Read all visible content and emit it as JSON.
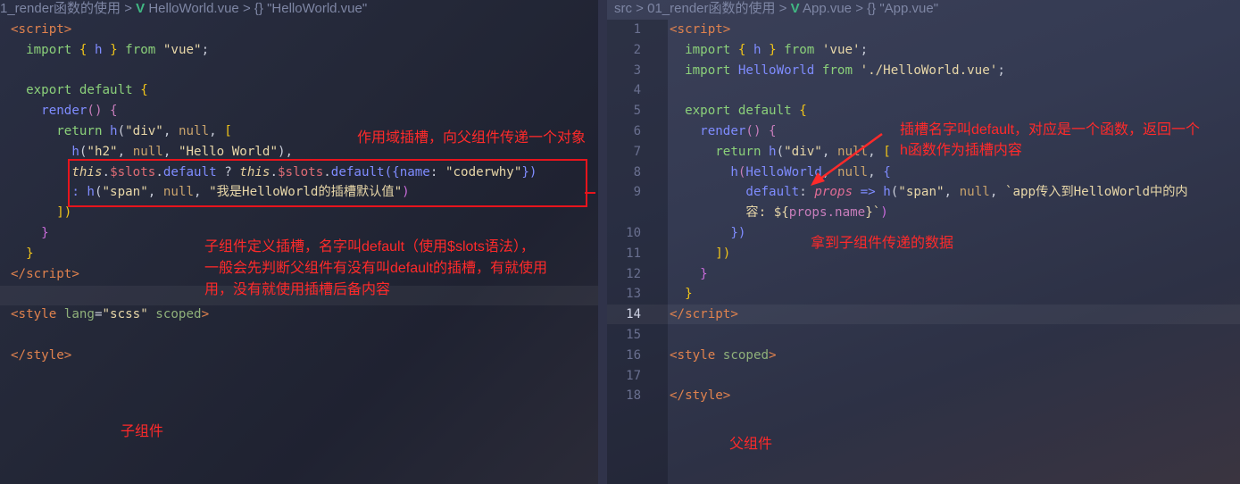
{
  "left": {
    "breadcrumb": {
      "folder": "1_render函数的使用",
      "file": "HelloWorld.vue",
      "symbol": "\"HelloWorld.vue\"",
      "sep": ">",
      "vue_icon": "V",
      "sym_icon": "{}"
    },
    "lines": [
      [
        [
          "<script>",
          "tag"
        ]
      ],
      [
        [
          "  import ",
          "kw"
        ],
        [
          "{ ",
          "br"
        ],
        [
          "h ",
          "fn"
        ],
        [
          "} ",
          "br"
        ],
        [
          "from ",
          "kw"
        ],
        [
          "\"vue\"",
          "str"
        ],
        [
          ";",
          "pu"
        ]
      ],
      [],
      [
        [
          "  export default ",
          "kw"
        ],
        [
          "{",
          "br"
        ]
      ],
      [
        [
          "    render",
          "fn"
        ],
        [
          "() ",
          "pr"
        ],
        [
          "{",
          "pr"
        ]
      ],
      [
        [
          "      return ",
          "kw"
        ],
        [
          "h",
          "fn"
        ],
        [
          "(",
          "pu"
        ],
        [
          "\"div\"",
          "str"
        ],
        [
          ", ",
          "pu"
        ],
        [
          "null",
          "nul"
        ],
        [
          ", ",
          "pu"
        ],
        [
          "[",
          "br"
        ]
      ],
      [
        [
          "        h",
          "fn"
        ],
        [
          "(",
          "pu"
        ],
        [
          "\"h2\"",
          "str"
        ],
        [
          ", ",
          "pu"
        ],
        [
          "null",
          "nul"
        ],
        [
          ", ",
          "pu"
        ],
        [
          "\"Hello World\"",
          "str"
        ],
        [
          "),",
          "pu"
        ]
      ],
      [
        [
          "        "
        ],
        [
          "this",
          "th"
        ],
        [
          ".",
          "pu"
        ],
        [
          "$slots",
          "sl"
        ],
        [
          ".",
          "pu"
        ],
        [
          "default",
          "fn"
        ],
        [
          " ? ",
          "pu"
        ],
        [
          "this",
          "th"
        ],
        [
          ".",
          "pu"
        ],
        [
          "$slots",
          "sl"
        ],
        [
          ".",
          "pu"
        ],
        [
          "default",
          "fn"
        ],
        [
          "({",
          "fn"
        ],
        [
          "name",
          "fn"
        ],
        [
          ": ",
          "pu"
        ],
        [
          "\"coderwhy\"",
          "str"
        ],
        [
          "})",
          "fn"
        ]
      ],
      [
        [
          "        : ",
          "fn"
        ],
        [
          "h",
          "fn"
        ],
        [
          "(",
          "pu"
        ],
        [
          "\"span\"",
          "str"
        ],
        [
          ", ",
          "pu"
        ],
        [
          "null",
          "nul"
        ],
        [
          ", ",
          "pu"
        ],
        [
          "\"我是HelloWorld的插槽默认值\"",
          "str"
        ],
        [
          ")",
          "pb"
        ]
      ],
      [
        [
          "      ])",
          "br"
        ]
      ],
      [
        [
          "    }",
          "pb"
        ]
      ],
      [
        [
          "  }",
          "br"
        ]
      ],
      [
        [
          "</script>",
          "tag"
        ]
      ],
      [],
      [
        [
          "<style ",
          "tag"
        ],
        [
          "lang",
          "at"
        ],
        [
          "=",
          "pu"
        ],
        [
          "\"scss\"",
          "str"
        ],
        [
          " scoped",
          "at"
        ],
        [
          ">",
          "tag"
        ]
      ],
      [],
      [
        [
          "</style>",
          "tag"
        ]
      ]
    ],
    "notes": {
      "scoped_slot": "作用域插槽，向父组件传递一个对象",
      "define_slot_1": "子组件定义插槽，名字叫default（使用$slots语法），",
      "define_slot_2": "一般会先判断父组件有没有叫default的插槽，有就使用",
      "define_slot_3": "用，没有就使用插槽后备内容",
      "label": "子组件"
    }
  },
  "right": {
    "breadcrumb": {
      "root": "src",
      "folder": "01_render函数的使用",
      "file": "App.vue",
      "symbol": "\"App.vue\"",
      "sep": ">",
      "vue_icon": "V",
      "sym_icon": "{}"
    },
    "current_line": 14,
    "lines": [
      {
        "n": "1",
        "t": [
          [
            "<script>",
            "tag"
          ]
        ]
      },
      {
        "n": "2",
        "t": [
          [
            "  import ",
            "kw"
          ],
          [
            "{ ",
            "br"
          ],
          [
            "h ",
            "fn"
          ],
          [
            "} ",
            "br"
          ],
          [
            "from ",
            "kw"
          ],
          [
            "'vue'",
            "str"
          ],
          [
            ";",
            "pu"
          ]
        ]
      },
      {
        "n": "3",
        "t": [
          [
            "  import ",
            "kw"
          ],
          [
            "HelloWorld ",
            "fn"
          ],
          [
            "from ",
            "kw"
          ],
          [
            "'./HelloWorld.vue'",
            "str"
          ],
          [
            ";",
            "pu"
          ]
        ]
      },
      {
        "n": "4",
        "t": []
      },
      {
        "n": "5",
        "t": [
          [
            "  export default ",
            "kw"
          ],
          [
            "{",
            "br"
          ]
        ]
      },
      {
        "n": "6",
        "t": [
          [
            "    render",
            "fn"
          ],
          [
            "() ",
            "pr"
          ],
          [
            "{",
            "pr"
          ]
        ]
      },
      {
        "n": "7",
        "t": [
          [
            "      return ",
            "kw"
          ],
          [
            "h",
            "fn"
          ],
          [
            "(",
            "pu"
          ],
          [
            "\"div\"",
            "str"
          ],
          [
            ", ",
            "pu"
          ],
          [
            "null",
            "nul"
          ],
          [
            ", ",
            "pu"
          ],
          [
            "[",
            "br"
          ]
        ]
      },
      {
        "n": "8",
        "t": [
          [
            "        h",
            "fn"
          ],
          [
            "(",
            "pr"
          ],
          [
            "HelloWorld",
            "fn"
          ],
          [
            ", ",
            "pu"
          ],
          [
            "null",
            "nul"
          ],
          [
            ", ",
            "pu"
          ],
          [
            "{",
            "fn"
          ]
        ]
      },
      {
        "n": "9",
        "t": [
          [
            "          default",
            "fn"
          ],
          [
            ": ",
            "pu"
          ],
          [
            "props",
            "it"
          ],
          [
            " => ",
            "fn"
          ],
          [
            "h",
            "fn"
          ],
          [
            "(",
            "pu"
          ],
          [
            "\"span\"",
            "str"
          ],
          [
            ", ",
            "pu"
          ],
          [
            "null",
            "nul"
          ],
          [
            ", ",
            "pu"
          ],
          [
            "`app传入到HelloWorld中的内",
            "str"
          ]
        ]
      },
      {
        "n": "",
        "t": [
          [
            "          容: ",
            "str"
          ],
          [
            "${",
            "str"
          ],
          [
            "props.name",
            "pr"
          ],
          [
            "}`",
            "str"
          ],
          [
            ")",
            "pb"
          ]
        ]
      },
      {
        "n": "10",
        "t": [
          [
            "        })",
            "fn"
          ]
        ]
      },
      {
        "n": "11",
        "t": [
          [
            "      ])",
            "br"
          ]
        ]
      },
      {
        "n": "12",
        "t": [
          [
            "    }",
            "pb"
          ]
        ]
      },
      {
        "n": "13",
        "t": [
          [
            "  }",
            "br"
          ]
        ]
      },
      {
        "n": "14",
        "t": [
          [
            "</script>",
            "tag"
          ]
        ]
      },
      {
        "n": "15",
        "t": []
      },
      {
        "n": "16",
        "t": [
          [
            "<style ",
            "tag"
          ],
          [
            "scoped",
            "at"
          ],
          [
            ">",
            "tag"
          ]
        ]
      },
      {
        "n": "17",
        "t": []
      },
      {
        "n": "18",
        "t": [
          [
            "</style>",
            "tag"
          ]
        ]
      }
    ],
    "notes": {
      "slot_name_1": "插槽名字叫default，对应是一个函数，返回一个",
      "slot_name_2": "h函数作为插槽内容",
      "get_data": "拿到子组件传递的数据",
      "label": "父组件"
    }
  },
  "colors": {
    "annotation": "#ff2a2a",
    "vue": "#41b883"
  }
}
